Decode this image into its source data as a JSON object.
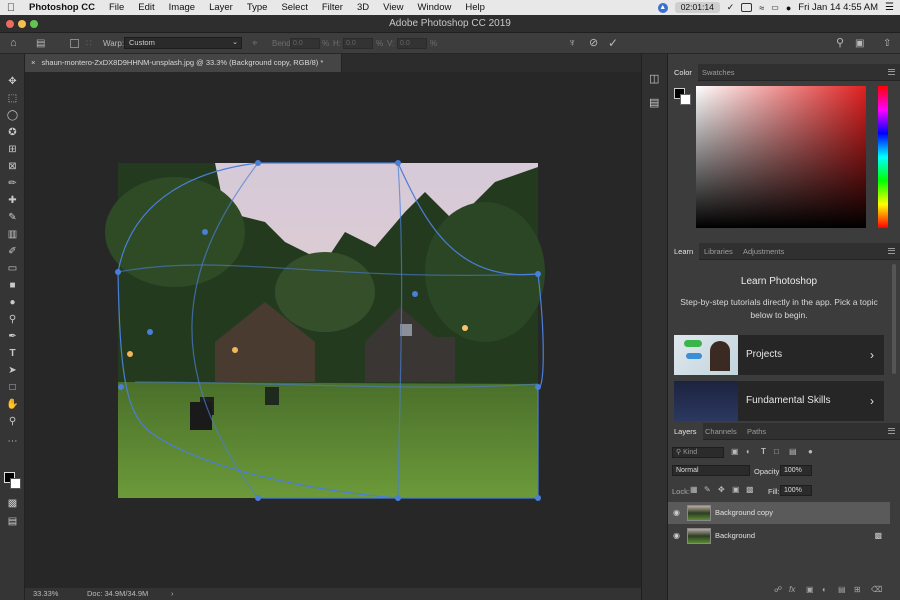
{
  "menubar": {
    "app": "Photoshop CC",
    "items": [
      "File",
      "Edit",
      "Image",
      "Layer",
      "Type",
      "Select",
      "Filter",
      "3D",
      "View",
      "Window",
      "Help"
    ],
    "timer": "02:01:14",
    "datetime": "Fri Jan 14  4:55 AM"
  },
  "window": {
    "title": "Adobe Photoshop CC 2019"
  },
  "options": {
    "warp_label": "Warp:",
    "warp_value": "Custom",
    "bend_label": "Bend:",
    "bend_value": "0.0",
    "h_label": "H:",
    "h_value": "0.0",
    "v_label": "V:",
    "v_value": "0.0",
    "percent": "%"
  },
  "document": {
    "tab_title": "shaun-montero-ZxDX8D9HHNM-unsplash.jpg @ 33.3% (Background copy, RGB/8) *",
    "zoom": "33.33%",
    "doc_info": "Doc: 34.9M/34.9M"
  },
  "panels": {
    "color_tabs": [
      "Color",
      "Swatches"
    ],
    "learn_tabs": [
      "Learn",
      "Libraries",
      "Adjustments"
    ],
    "learn_title": "Learn Photoshop",
    "learn_desc": "Step-by-step tutorials directly in the app. Pick a topic below to begin.",
    "learn_cards": [
      "Projects",
      "Fundamental Skills"
    ],
    "layers_tabs": [
      "Layers",
      "Channels",
      "Paths"
    ],
    "kind_label": "Kind",
    "blend_mode": "Normal",
    "opacity_label": "Opacity:",
    "opacity_value": "100%",
    "lock_label": "Lock:",
    "fill_label": "Fill:",
    "fill_value": "100%",
    "layers": [
      {
        "name": "Background copy",
        "selected": true,
        "locked": false
      },
      {
        "name": "Background",
        "selected": false,
        "locked": true
      }
    ]
  },
  "colors": {
    "accent": "#4a7fd8",
    "panel_bg": "#3c3c3c",
    "canvas_bg": "#272727",
    "selected_layer": "#5a5a5a"
  }
}
